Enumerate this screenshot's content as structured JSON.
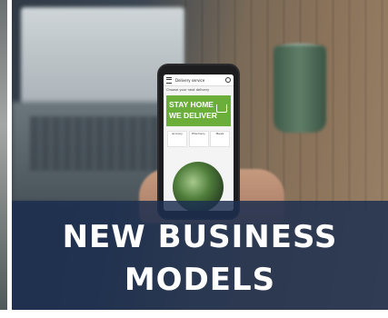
{
  "phone_app": {
    "title": "Delivery service",
    "subtitle": "Choose your next delivery",
    "banner_line1": "STAY HOME",
    "banner_line2": "WE DELIVER",
    "categories": [
      "Grocery",
      "Pharmacy",
      "Meals"
    ]
  },
  "overlay": {
    "line1": "NEW BUSINESS",
    "line2": "MODELS"
  },
  "colors": {
    "overlay_bg": "#1c2e50",
    "banner_green": "#6cae3a"
  },
  "icons": [
    "menu-icon",
    "search-icon",
    "cart-icon"
  ]
}
